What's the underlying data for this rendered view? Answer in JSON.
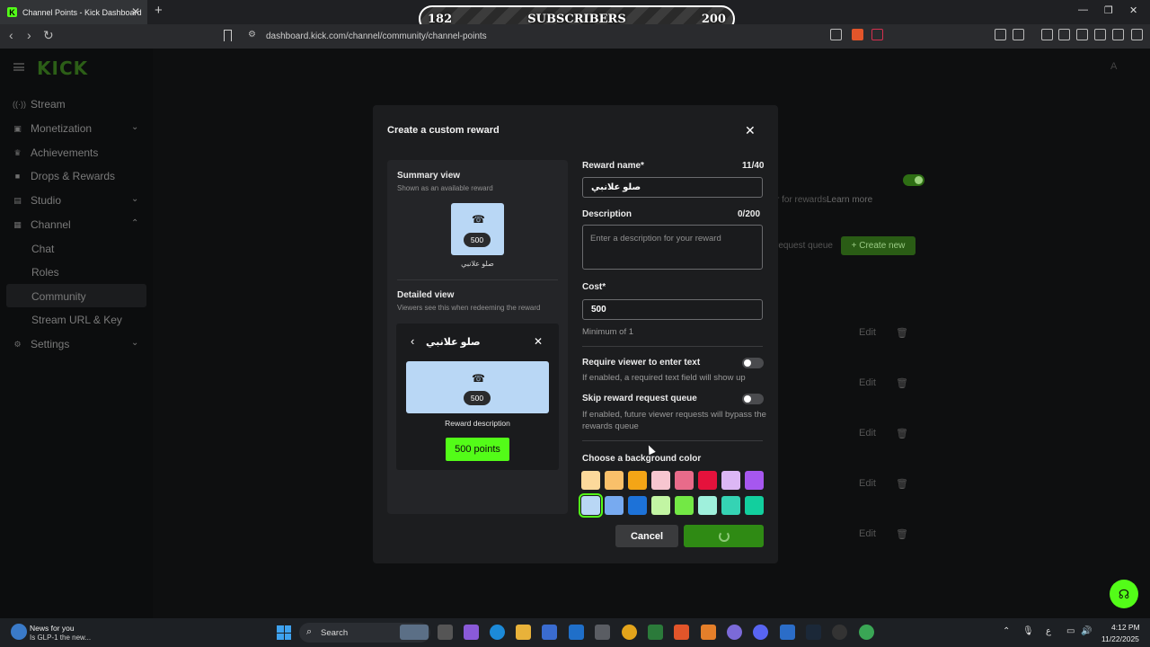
{
  "browser": {
    "tab_title": "Channel Points - Kick Dashboard",
    "tab_favicon": "K",
    "url": "dashboard.kick.com/channel/community/channel-points",
    "overlay": {
      "left_count": "182",
      "label": "SUBSCRIBERS",
      "right_count": "200"
    }
  },
  "sidebar": {
    "logo": "KICK",
    "items": [
      {
        "label": "Stream"
      },
      {
        "label": "Monetization"
      },
      {
        "label": "Achievements"
      },
      {
        "label": "Drops & Rewards"
      },
      {
        "label": "Studio"
      },
      {
        "label": "Channel"
      },
      {
        "label": "Chat"
      },
      {
        "label": "Roles"
      },
      {
        "label": "Community"
      },
      {
        "label": "Stream URL & Key"
      },
      {
        "label": "Settings"
      }
    ]
  },
  "background": {
    "rewards_text": "r for rewards.",
    "learn_more": "Learn more",
    "request_queue": "request queue",
    "create_new": "Create new",
    "edit_label": "Edit"
  },
  "modal": {
    "title": "Create a custom reward",
    "summary_title": "Summary view",
    "summary_sub": "Shown as an available reward",
    "detailed_title": "Detailed view",
    "detailed_sub": "Viewers see this when redeeming the reward",
    "cost_display": "500",
    "reward_name_preview": "صلو علانبي",
    "reward_description_preview": "Reward description",
    "points_button": "500 points",
    "form": {
      "name_label": "Reward name*",
      "name_count": "11/40",
      "name_value": "صلو علانبي",
      "desc_label": "Description",
      "desc_count": "0/200",
      "desc_placeholder": "Enter a description for your reward",
      "cost_label": "Cost*",
      "cost_value": "500",
      "cost_help": "Minimum of 1",
      "require_text_label": "Require viewer to enter text",
      "require_text_help": "If enabled, a required text field will show up",
      "skip_queue_label": "Skip reward request queue",
      "skip_queue_help": "If enabled, future viewer requests will bypass the rewards queue",
      "color_label": "Choose a background color"
    },
    "colors": [
      "#fcd99b",
      "#f9c06a",
      "#f4a516",
      "#f7c6d0",
      "#e86b8a",
      "#e5123c",
      "#dcb7f5",
      "#a657ef",
      "#b9d7f5",
      "#77aaf0",
      "#1d72d8",
      "#c2f5a3",
      "#73e845",
      "#9ff0dc",
      "#35d3b4",
      "#12cf9e"
    ],
    "selected_color_index": 8,
    "cancel_label": "Cancel"
  },
  "taskbar": {
    "news_title": "News for you",
    "news_sub": "Is GLP-1 the new...",
    "search_label": "Search",
    "time": "4:12 PM",
    "date": "11/22/2025"
  }
}
